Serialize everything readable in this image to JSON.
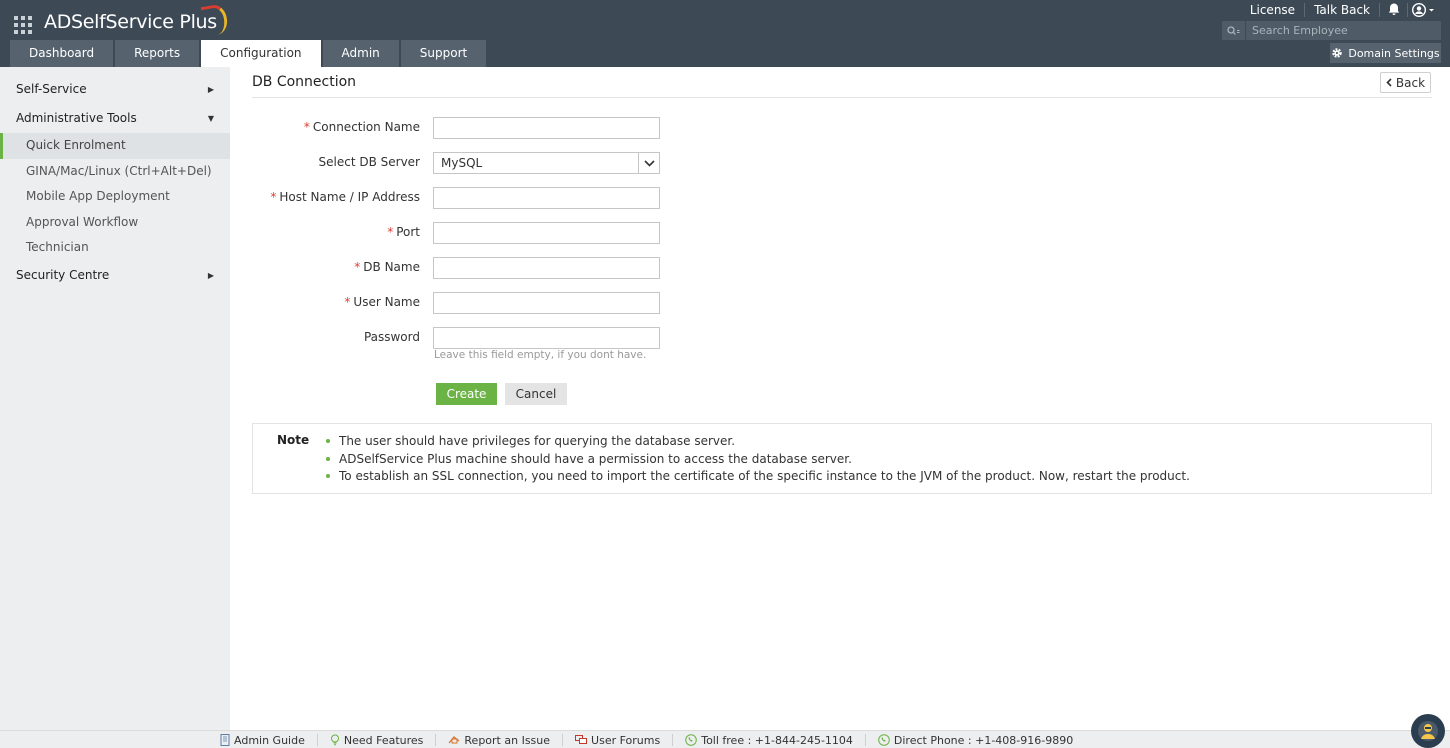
{
  "app": {
    "logo_text": "ADSelfService Plus"
  },
  "header": {
    "links": [
      "License",
      "Talk Back"
    ],
    "search_placeholder": "Search Employee",
    "tabs": [
      {
        "label": "Dashboard",
        "active": false
      },
      {
        "label": "Reports",
        "active": false
      },
      {
        "label": "Configuration",
        "active": true
      },
      {
        "label": "Admin",
        "active": false
      },
      {
        "label": "Support",
        "active": false
      }
    ],
    "domain_settings": "Domain Settings"
  },
  "sidebar": {
    "groups": [
      {
        "label": "Self-Service",
        "expanded": false
      },
      {
        "label": "Administrative Tools",
        "expanded": true
      },
      {
        "label": "Security Centre",
        "expanded": false
      }
    ],
    "items": [
      {
        "label": "Quick Enrolment",
        "active": true
      },
      {
        "label": "GINA/Mac/Linux (Ctrl+Alt+Del)",
        "active": false
      },
      {
        "label": "Mobile App Deployment",
        "active": false
      },
      {
        "label": "Approval Workflow",
        "active": false
      },
      {
        "label": "Technician",
        "active": false
      }
    ]
  },
  "main": {
    "title": "DB Connection",
    "back_label": "Back",
    "form": {
      "required_mark": "*",
      "fields": [
        {
          "label": "Connection Name",
          "required": true,
          "value": ""
        },
        {
          "label": "Select DB Server",
          "required": false,
          "value": "MySQL"
        },
        {
          "label": "Host Name / IP Address",
          "required": true,
          "value": ""
        },
        {
          "label": "Port",
          "required": true,
          "value": ""
        },
        {
          "label": "DB Name",
          "required": true,
          "value": ""
        },
        {
          "label": "User Name",
          "required": true,
          "value": ""
        },
        {
          "label": "Password",
          "required": false,
          "value": ""
        }
      ],
      "password_hint": "Leave this field empty, if you dont have.",
      "create_label": "Create",
      "cancel_label": "Cancel"
    },
    "note": {
      "title": "Note",
      "items": [
        "The user should have privileges for querying the database server.",
        "ADSelfService Plus machine should have a permission to access the database server.",
        "To establish an SSL connection, you need to import the certificate of the specific instance to the JVM of the product. Now, restart the product."
      ]
    }
  },
  "footer": {
    "links": [
      {
        "label": "Admin Guide",
        "icon": "book-icon"
      },
      {
        "label": "Need Features",
        "icon": "bulb-icon"
      },
      {
        "label": "Report an Issue",
        "icon": "bug-icon"
      },
      {
        "label": "User Forums",
        "icon": "forum-icon"
      },
      {
        "label": "Toll free : +1-844-245-1104",
        "icon": "phone-icon"
      },
      {
        "label": "Direct Phone : +1-408-916-9890",
        "icon": "phone-icon"
      }
    ]
  },
  "colors": {
    "header_bg": "#3d4a56",
    "tab_bg": "#56636f",
    "accent_green": "#6ab344",
    "required_red": "#e03b2f"
  }
}
